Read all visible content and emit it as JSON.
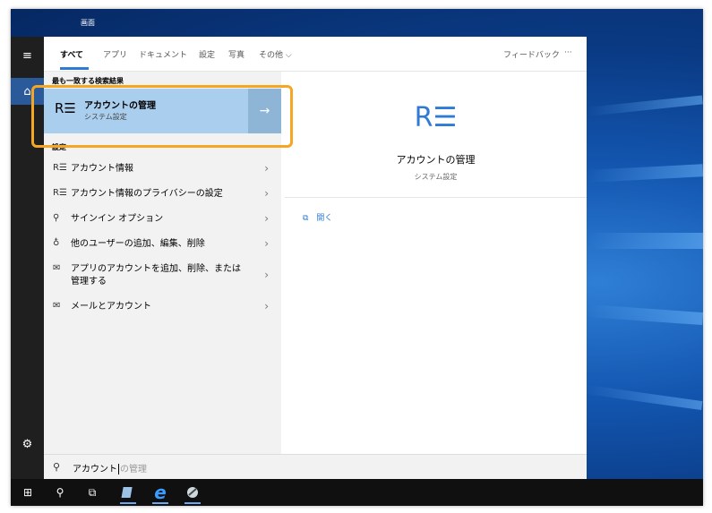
{
  "window": {
    "top_label": "画面"
  },
  "tabs": [
    {
      "label": "すべて",
      "active": true
    },
    {
      "label": "アプリ"
    },
    {
      "label": "ドキュメント"
    },
    {
      "label": "設定"
    },
    {
      "label": "写真"
    },
    {
      "label": "その他"
    }
  ],
  "tabs_more_chevron": "⌵",
  "feedback_label": "フィードバック",
  "more_label": "···",
  "best_match": {
    "section_title": "最も一致する検索結果",
    "title": "アカウントの管理",
    "subtitle": "システム設定",
    "icon": "account-icon"
  },
  "settings": {
    "section_title": "設定",
    "items": [
      {
        "label": "アカウント情報",
        "icon": "account-icon"
      },
      {
        "label": "アカウント情報のプライバシーの設定",
        "icon": "account-icon"
      },
      {
        "label": "サインイン オプション",
        "icon": "key-icon"
      },
      {
        "label": "他のユーザーの追加、編集、削除",
        "icon": "person-icon"
      },
      {
        "label": "アプリのアカウントを追加、削除、または管理する",
        "icon": "mail-icon"
      },
      {
        "label": "メールとアカウント",
        "icon": "mail-icon"
      }
    ]
  },
  "preview": {
    "title": "アカウントの管理",
    "subtitle": "システム設定",
    "open_label": "開く"
  },
  "search": {
    "typed": "アカウント",
    "hint": "の管理"
  },
  "glyphs": {
    "account": "R☰",
    "key": "⚲",
    "person": "♁",
    "mail": "✉",
    "chevron": "›",
    "arrow": "→",
    "menu": "≡",
    "home": "⌂",
    "gear": "⚙",
    "windows": "⊞",
    "search": "⚲",
    "taskview": "⧉",
    "edge": "e",
    "open": "⧉"
  }
}
